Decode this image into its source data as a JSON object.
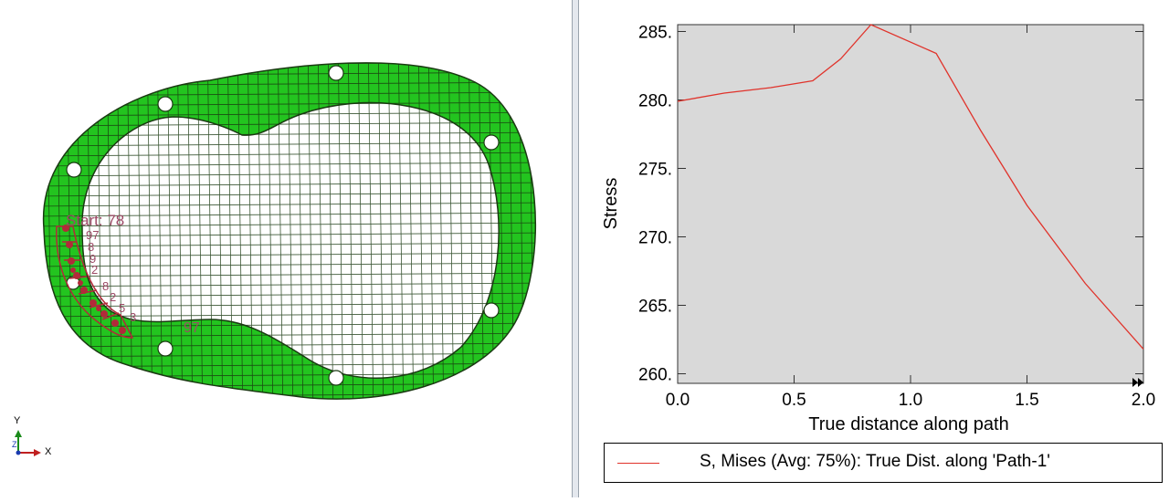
{
  "colors": {
    "mesh_fill": "#23c41f",
    "mesh_lines": "#1a3a12",
    "path_highlight": "#b22a3a",
    "path_label": "#9c4a66",
    "plot_background": "#d9d9d9",
    "series_line": "#e0332b"
  },
  "viewport": {
    "path_start_label": "Start: 78",
    "path_end_label_fragment": "97",
    "triad": {
      "y_label": "Y",
      "x_label": "X",
      "z_label": "Z"
    }
  },
  "chart_data": {
    "type": "line",
    "xlabel": "True distance along path",
    "ylabel": "Stress",
    "xlim": [
      0.0,
      2.0
    ],
    "ylim": [
      259.3,
      285.5
    ],
    "x_ticks": [
      "0.0",
      "0.5",
      "1.0",
      "1.5",
      "2.0"
    ],
    "y_ticks": [
      "260.",
      "265.",
      "270.",
      "275.",
      "280.",
      "285."
    ],
    "grid": false,
    "legend_placement": "bottom",
    "series": [
      {
        "name": "S, Mises (Avg: 75%): True Dist. along 'Path-1'",
        "x": [
          0.0,
          0.2,
          0.4,
          0.58,
          0.7,
          0.83,
          1.11,
          1.3,
          1.5,
          1.75,
          2.0
        ],
        "y": [
          279.9,
          280.5,
          280.9,
          281.4,
          283.0,
          285.6,
          283.4,
          277.8,
          272.3,
          266.6,
          261.8
        ]
      }
    ]
  }
}
